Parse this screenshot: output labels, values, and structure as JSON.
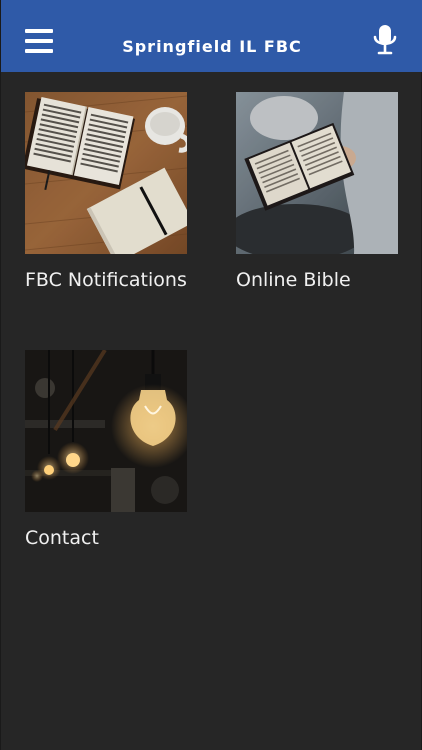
{
  "header": {
    "title": "Springfield IL FBC",
    "menu_icon": "hamburger-menu-icon",
    "mic_icon": "microphone-icon",
    "bar_color": "#2f5aa8"
  },
  "tiles": [
    {
      "label": "FBC Notifications",
      "image": "open-bible-with-coffee-photo"
    },
    {
      "label": "Online Bible",
      "image": "person-reading-bible-photo"
    },
    {
      "label": "Contact",
      "image": "light-bulbs-photo"
    }
  ]
}
